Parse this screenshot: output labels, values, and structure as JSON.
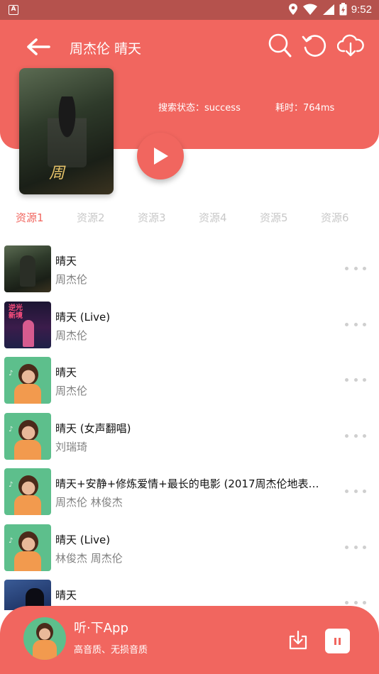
{
  "status_bar": {
    "time": "9:52",
    "app_badge": "A"
  },
  "header": {
    "title": "周杰伦 晴天",
    "search_status": "搜索状态：success",
    "elapsed": "耗时：764ms"
  },
  "album": {
    "cover_text": "周"
  },
  "tabs": [
    {
      "label": "资源1",
      "active": true
    },
    {
      "label": "资源2",
      "active": false
    },
    {
      "label": "资源3",
      "active": false
    },
    {
      "label": "资源4",
      "active": false
    },
    {
      "label": "资源5",
      "active": false
    },
    {
      "label": "资源6",
      "active": false
    }
  ],
  "songs": [
    {
      "title": "晴天",
      "artist": "周杰伦",
      "cover": "album"
    },
    {
      "title": "晴天 (Live)",
      "artist": "周杰伦",
      "cover": "live"
    },
    {
      "title": "晴天",
      "artist": "周杰伦",
      "cover": "green-illustration"
    },
    {
      "title": "晴天 (女声翻唱)",
      "artist": "刘瑞琦",
      "cover": "green-illustration"
    },
    {
      "title": "晴天+安静+修炼爱情+最长的电影 (2017周杰伦地表最...",
      "artist": "周杰伦  林俊杰",
      "cover": "green-illustration"
    },
    {
      "title": "晴天 (Live)",
      "artist": "林俊杰  周杰伦",
      "cover": "green-illustration"
    },
    {
      "title": "晴天",
      "artist": "",
      "cover": "blue"
    }
  ],
  "mini_player": {
    "title": "听·下App",
    "subtitle": "高音质、无损音质"
  },
  "colors": {
    "accent": "#f1665f",
    "status_bar": "#b5524d",
    "tab_inactive": "#c8c8c8",
    "artist_text": "#808080"
  },
  "icons": [
    "back-arrow-icon",
    "search-icon",
    "refresh-icon",
    "cloud-download-icon",
    "play-icon",
    "more-icon",
    "download-icon",
    "pause-icon"
  ]
}
